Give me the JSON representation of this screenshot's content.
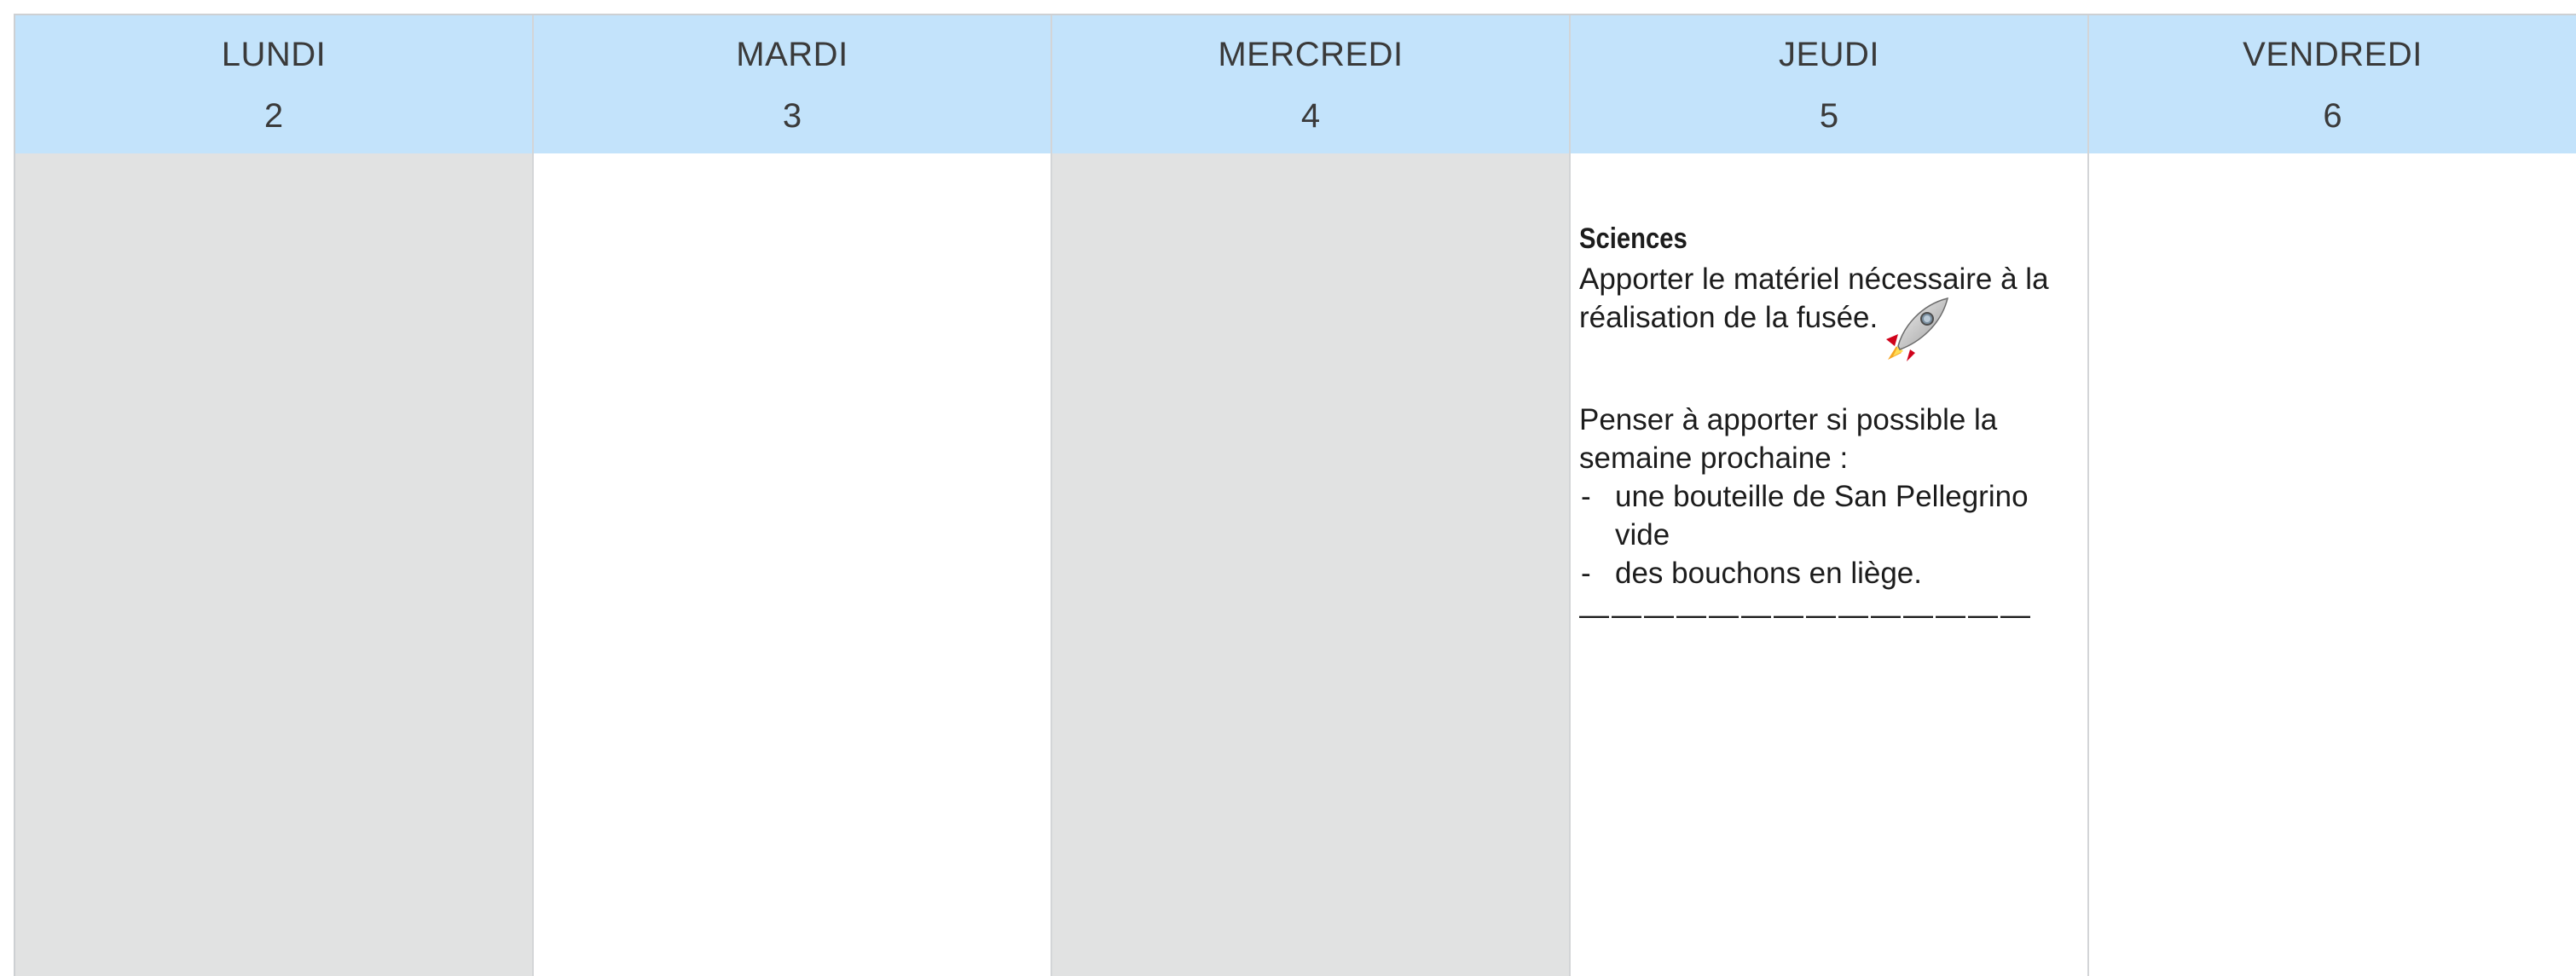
{
  "days": [
    {
      "name": "LUNDI",
      "number": "2"
    },
    {
      "name": "MARDI",
      "number": "3"
    },
    {
      "name": "MERCREDI",
      "number": "4"
    },
    {
      "name": "JEUDI",
      "number": "5"
    },
    {
      "name": "VENDREDI",
      "number": "6"
    }
  ],
  "note": {
    "title": "Sciences",
    "line1": "Apporter le matériel nécessaire à la réalisation de la fusée.",
    "line2": "Penser à apporter si possible la semaine prochaine :",
    "items": [
      {
        "dash": "-",
        "text": "une bouteille de San Pellegrino vide"
      },
      {
        "dash": "-",
        "text": "des bouchons en liège."
      }
    ],
    "separator": "——————————————",
    "icon": "rocket-icon"
  },
  "colors": {
    "header_bg": "#c3e3fb",
    "weekend_like_bg": "#e1e2e2",
    "text": "#3a3a3a"
  }
}
